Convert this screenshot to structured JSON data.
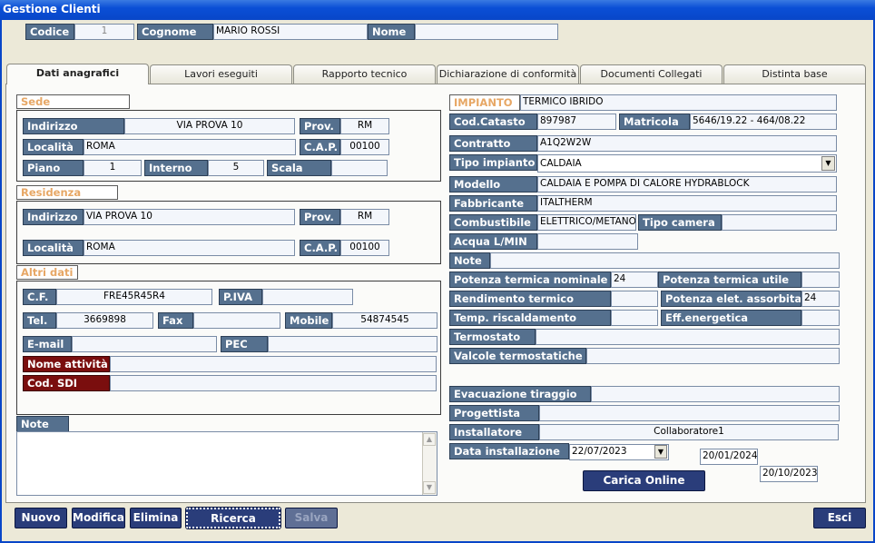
{
  "window": {
    "title": "Gestione Clienti"
  },
  "header": {
    "codice_label": "Codice",
    "codice_value": "1",
    "cognome_label": "Cognome",
    "cognome_value": "MARIO ROSSI",
    "nome_label": "Nome",
    "nome_value": ""
  },
  "tabs": [
    {
      "label": "Dati anagrafici"
    },
    {
      "label": "Lavori eseguiti"
    },
    {
      "label": "Rapporto tecnico"
    },
    {
      "label": "Dichiarazione di conformità"
    },
    {
      "label": "Documenti Collegati"
    },
    {
      "label": "Distinta base"
    }
  ],
  "sede": {
    "title": "Sede",
    "indirizzo_label": "Indirizzo",
    "indirizzo": "VIA PROVA 10",
    "prov_label": "Prov.",
    "prov": "RM",
    "localita_label": "Località",
    "localita": "ROMA",
    "cap_label": "C.A.P.",
    "cap": "00100",
    "piano_label": "Piano",
    "piano": "1",
    "interno_label": "Interno",
    "interno": "5",
    "scala_label": "Scala",
    "scala": ""
  },
  "residenza": {
    "title": "Residenza",
    "indirizzo_label": "Indirizzo",
    "indirizzo": "VIA PROVA 10",
    "prov_label": "Prov.",
    "prov": "RM",
    "localita_label": "Località",
    "localita": "ROMA",
    "cap_label": "C.A.P.",
    "cap": "00100"
  },
  "altri": {
    "title": "Altri dati",
    "cf_label": "C.F.",
    "cf": "FRE45R45R4",
    "piva_label": "P.IVA",
    "piva": "",
    "tel_label": "Tel.",
    "tel": "3669898",
    "fax_label": "Fax",
    "fax": "",
    "mobile_label": "Mobile",
    "mobile": "54874545",
    "email_label": "E-mail",
    "email": "",
    "pec_label": "PEC",
    "pec": "",
    "attivita_label": "Nome attività",
    "attivita": "",
    "sdi_label": "Cod. SDI",
    "sdi": ""
  },
  "note": {
    "label": "Note",
    "value": ""
  },
  "impianto": {
    "title": "IMPIANTO",
    "value": "TERMICO IBRIDO",
    "catasto_label": "Cod.Catasto",
    "catasto": "897987",
    "matricola_label": "Matricola",
    "matricola": "5646/19.22 - 464/08.22",
    "contratto_label": "Contratto",
    "contratto": "A1Q2W2W",
    "tipo_label": "Tipo impianto",
    "tipo": "CALDAIA",
    "modello_label": "Modello",
    "modello": "CALDAIA E POMPA DI CALORE HYDRABLOCK",
    "fabbricante_label": "Fabbricante",
    "fabbricante": "ITALTHERM",
    "combustibile_label": "Combustibile",
    "combustibile": "ELETTRICO/METANO",
    "camera_label": "Tipo camera",
    "camera": "",
    "acqua_label": "Acqua L/MIN",
    "acqua": "",
    "note_label": "Note",
    "note": "",
    "pot_nom_label": "Potenza termica nominale",
    "pot_nom": "24",
    "pot_utile_label": "Potenza termica utile",
    "pot_utile": "",
    "rendimento_label": "Rendimento termico",
    "rendimento": "",
    "pot_elet_label": "Potenza elet. assorbita",
    "pot_elet": "24",
    "temp_label": "Temp. riscaldamento",
    "temp": "",
    "eff_label": "Eff.energetica",
    "eff": "",
    "termostato_label": "Termostato",
    "termostato": "",
    "valvole_label": "Valcole termostatiche",
    "valvole": "",
    "evacuazione_label": "Evacuazione tiraggio",
    "evacuazione": "",
    "progettista_label": "Progettista",
    "progettista": "",
    "installatore_label": "Installatore",
    "installatore": "Collaboratore1",
    "data_inst_label": "Data installazione",
    "data_inst": "22/07/2023",
    "date_extra_1": "20/01/2024",
    "date_extra_2": "20/10/2023",
    "carica_label": "Carica Online"
  },
  "toolbar": {
    "nuovo": "Nuovo",
    "modifica": "Modifica",
    "elimina": "Elimina",
    "ricerca": "Ricerca",
    "salva": "Salva",
    "esci": "Esci"
  }
}
